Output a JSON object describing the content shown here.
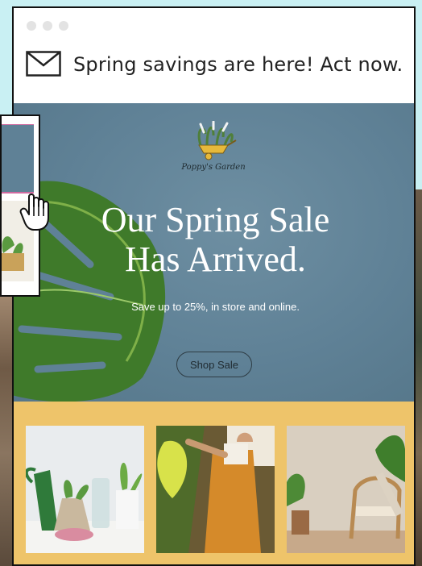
{
  "email": {
    "subject": "Spring savings are here! Act now."
  },
  "hero": {
    "brand_name": "Poppy's Garden",
    "headline_line1": "Our Spring Sale",
    "headline_line2": "Has Arrived.",
    "subheadline": "Save up to 25%, in store and online.",
    "cta_label": "Shop Sale"
  },
  "colors": {
    "background": "#c9f0f3",
    "hero_blue": "#5f8196",
    "band_yellow": "#eec46a"
  },
  "icons": {
    "mail": "mail-icon",
    "cursor": "hand-pointer-icon"
  }
}
